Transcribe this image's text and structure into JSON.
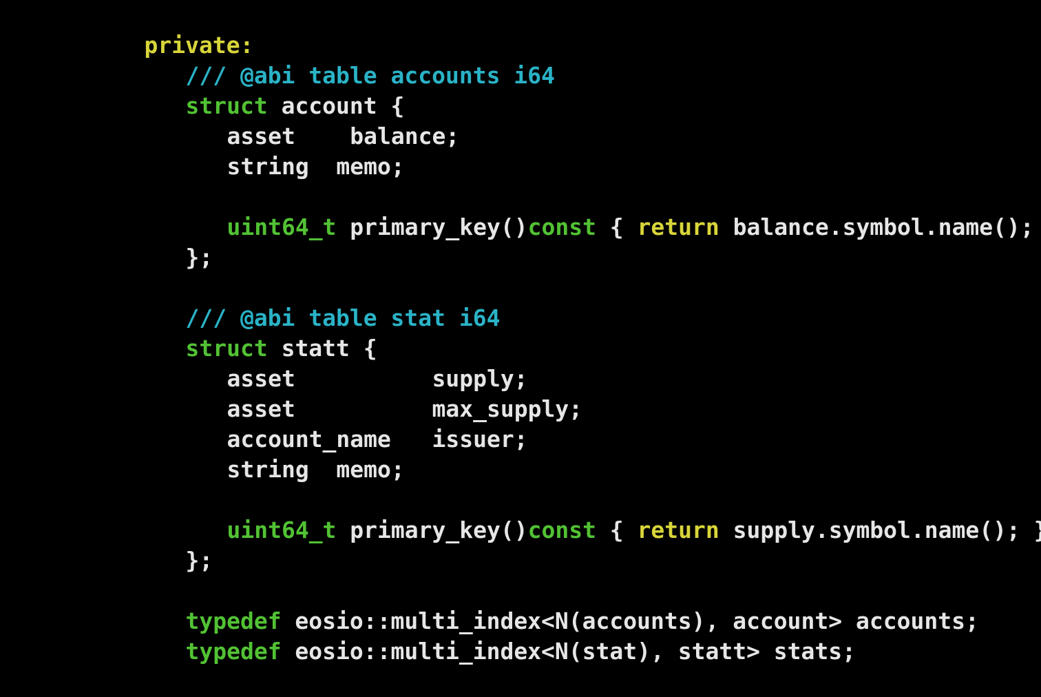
{
  "colors": {
    "background": "#000000",
    "access_specifier": "#d8d53a",
    "comment": "#2ab3c7",
    "keyword": "#52c234",
    "return_keyword": "#d8d53a",
    "plain_text": "#e6e6e6"
  },
  "code": {
    "l01": {
      "t1": "private:"
    },
    "l02": {
      "t1": "/// @abi table accounts i64"
    },
    "l03": {
      "t1": "struct",
      "t2": " account {"
    },
    "l04": {
      "t1": "asset    balance;"
    },
    "l05": {
      "t1": "string  memo;"
    },
    "l06": {
      "t1": "uint64_t",
      "t2": " primary_key()",
      "t3": "const",
      "t4": " { ",
      "t5": "return",
      "t6": " balance.symbol.name(); }"
    },
    "l07": {
      "t1": "};"
    },
    "l08": {
      "t1": "/// @abi table stat i64"
    },
    "l09": {
      "t1": "struct",
      "t2": " statt {"
    },
    "l10": {
      "t1": "asset          supply;"
    },
    "l11": {
      "t1": "asset          max_supply;"
    },
    "l12": {
      "t1": "account_name   issuer;"
    },
    "l13": {
      "t1": "string  memo;"
    },
    "l14": {
      "t1": "uint64_t",
      "t2": " primary_key()",
      "t3": "const",
      "t4": " { ",
      "t5": "return",
      "t6": " supply.symbol.name(); }"
    },
    "l15": {
      "t1": "};"
    },
    "l16": {
      "t1": "typedef",
      "t2": " eosio::multi_index<N(accounts), account> accounts;"
    },
    "l17": {
      "t1": "typedef",
      "t2": " eosio::multi_index<N(stat), statt> stats;"
    }
  }
}
